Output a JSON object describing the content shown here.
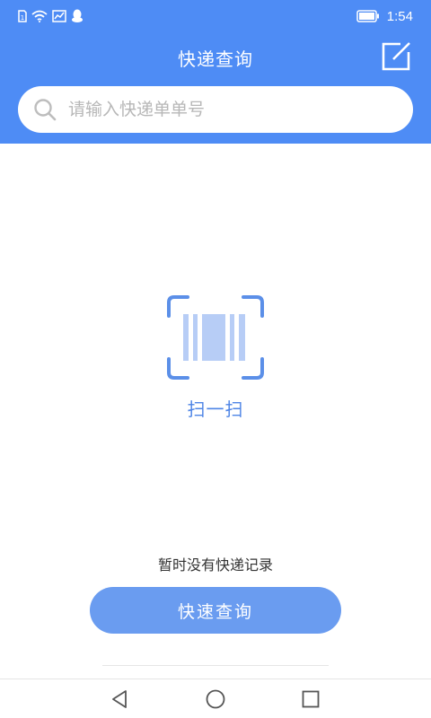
{
  "status_bar": {
    "time": "1:54",
    "icons": [
      "sim-icon",
      "wifi-icon",
      "chart-icon",
      "qq-icon",
      "battery-icon"
    ]
  },
  "header": {
    "title": "快递查询",
    "edit_icon": "edit-icon"
  },
  "search": {
    "placeholder": "请输入快递单单号",
    "value": ""
  },
  "scan": {
    "label": "扫一扫",
    "icon": "barcode-scan-icon"
  },
  "empty_state": {
    "text": "暂时没有快递记录"
  },
  "query_button": {
    "label": "快速查询"
  },
  "nav": {
    "icons": [
      "back-icon",
      "home-icon",
      "recent-apps-icon"
    ]
  },
  "colors": {
    "header_bg": "#4e8cf5",
    "accent": "#4e85e6",
    "button_bg": "#6a9cf0",
    "placeholder": "#b7b7b7"
  }
}
